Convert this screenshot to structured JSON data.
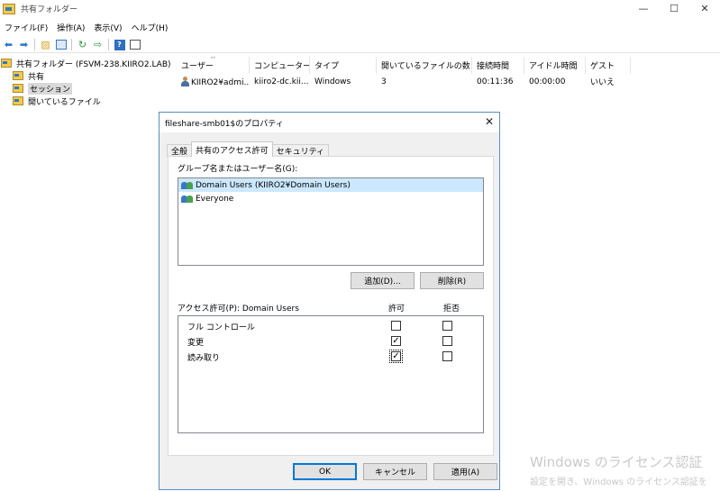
{
  "window": {
    "title": "共有フォルダー",
    "controls": {
      "minimize": "—",
      "maximize": "☐",
      "close": "✕"
    }
  },
  "menu": [
    "ファイル(F)",
    "操作(A)",
    "表示(V)",
    "ヘルプ(H)"
  ],
  "tree": {
    "root": "共有フォルダー (FSVM-238.KIIRO2.LAB)",
    "children": [
      "共有",
      "セッション",
      "開いているファイル"
    ],
    "selected": "セッション"
  },
  "list": {
    "columns": [
      "ユーザー",
      "コンピューター",
      "タイプ",
      "開いているファイルの数",
      "接続時間",
      "アイドル時間",
      "ゲスト"
    ],
    "sort_indicator": "^",
    "rows": [
      [
        "KIIRO2¥admi...",
        "kiiro2-dc.kii...",
        "Windows",
        "3",
        "00:11:36",
        "00:00:00",
        "いいえ"
      ]
    ]
  },
  "dialog": {
    "title": "fileshare-smb01$のプロパティ",
    "close": "✕",
    "tabs": [
      "全般",
      "共有のアクセス許可",
      "セキュリティ"
    ],
    "active_tab": 1,
    "group_label": "グループ名またはユーザー名(G):",
    "principals": [
      "Domain Users (KIIRO2¥Domain Users)",
      "Everyone"
    ],
    "selected_principal": 0,
    "add_button": "追加(D)...",
    "remove_button": "削除(R)",
    "perm_label": "アクセス許可(P): Domain Users",
    "allow_header": "許可",
    "deny_header": "拒否",
    "permissions": [
      {
        "name": "フル コントロール",
        "allow": false,
        "deny": false
      },
      {
        "name": "変更",
        "allow": true,
        "deny": false
      },
      {
        "name": "読み取り",
        "allow": true,
        "deny": false
      }
    ],
    "ok_button": "OK",
    "cancel_button": "キャンセル",
    "apply_button": "適用(A)"
  },
  "watermark": {
    "line1": "Windows のライセンス認証",
    "line2": "設定を開き、Windows のライセンス認証を"
  },
  "colors": {
    "accent": "#0078d7",
    "selection": "#cce8ff",
    "dialog_border": "#5a8cc6"
  }
}
